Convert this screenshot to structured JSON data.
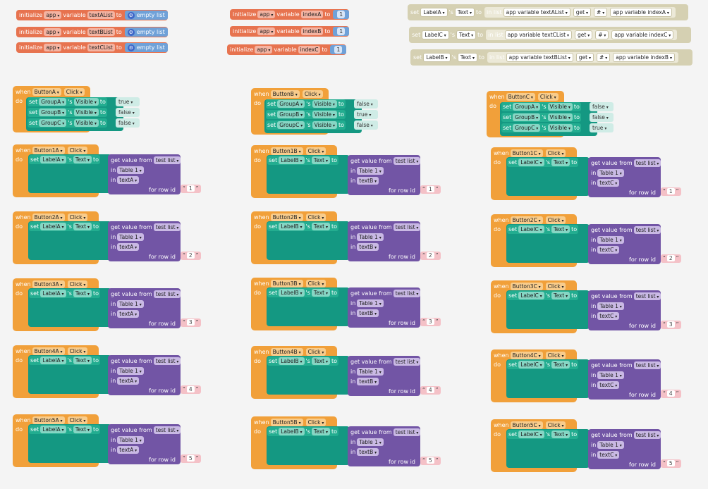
{
  "labels": {
    "initialize": "initialize",
    "app": "app",
    "variable": "variable",
    "to": "to",
    "empty_list": "empty list",
    "set": "set",
    "s_text": "'s",
    "text": "Text",
    "in_list": "in list",
    "app_variable": "app variable",
    "get": "get",
    "hash": "#",
    "when": "when",
    "click": "Click",
    "do": "do",
    "visible": "Visible",
    "get_value_from": "get value from",
    "test_list": "test list",
    "in": "in",
    "table1": "Table 1",
    "for_row_id": "for row id",
    "open_quote": "“",
    "close_quote": "”"
  },
  "initializers": [
    {
      "name": "textAList"
    },
    {
      "name": "textBList"
    },
    {
      "name": "textCList"
    }
  ],
  "index_inits": [
    {
      "name": "indexA",
      "value": "1"
    },
    {
      "name": "indexB",
      "value": "1"
    },
    {
      "name": "indexC",
      "value": "1"
    }
  ],
  "tan_sets": [
    {
      "label": "LabelA",
      "list": "app variable textAList",
      "index": "app variable indexA"
    },
    {
      "label": "LabelC",
      "list": "app variable textCList",
      "index": "app variable indexC"
    },
    {
      "label": "LabelB",
      "list": "app variable textBList",
      "index": "app variable indexB"
    }
  ],
  "visibility_handlers": [
    {
      "button": "ButtonA",
      "rows": [
        {
          "group": "GroupA",
          "value": "true"
        },
        {
          "group": "GroupB",
          "value": "false"
        },
        {
          "group": "GroupC",
          "value": "false"
        }
      ]
    },
    {
      "button": "ButtonB",
      "rows": [
        {
          "group": "GroupA",
          "value": "false"
        },
        {
          "group": "GroupB",
          "value": "true"
        },
        {
          "group": "GroupC",
          "value": "false"
        }
      ]
    },
    {
      "button": "ButtonC",
      "rows": [
        {
          "group": "GroupA",
          "value": "false"
        },
        {
          "group": "GroupB",
          "value": "false"
        },
        {
          "group": "GroupC",
          "value": "true"
        }
      ]
    }
  ],
  "value_handlers": [
    {
      "button": "Button1A",
      "label": "LabelA",
      "field": "textA",
      "row": "1"
    },
    {
      "button": "Button1B",
      "label": "LabelB",
      "field": "textB",
      "row": "1"
    },
    {
      "button": "Button1C",
      "label": "LabelC",
      "field": "textC",
      "row": "1"
    },
    {
      "button": "Button2A",
      "label": "LabelA",
      "field": "textA",
      "row": "2"
    },
    {
      "button": "Button2B",
      "label": "LabelB",
      "field": "textB",
      "row": "2"
    },
    {
      "button": "Button2C",
      "label": "LabelC",
      "field": "textC",
      "row": "2"
    },
    {
      "button": "Button3A",
      "label": "LabelA",
      "field": "textA",
      "row": "3"
    },
    {
      "button": "Button3B",
      "label": "LabelB",
      "field": "textB",
      "row": "3"
    },
    {
      "button": "Button3C",
      "label": "LabelC",
      "field": "textC",
      "row": "3"
    },
    {
      "button": "Button4A",
      "label": "LabelA",
      "field": "textA",
      "row": "4"
    },
    {
      "button": "Button4B",
      "label": "LabelB",
      "field": "textB",
      "row": "4"
    },
    {
      "button": "Button4C",
      "label": "LabelC",
      "field": "textC",
      "row": "4"
    },
    {
      "button": "Button5A",
      "label": "LabelA",
      "field": "textA",
      "row": "5"
    },
    {
      "button": "Button5B",
      "label": "LabelB",
      "field": "textB",
      "row": "5"
    },
    {
      "button": "Button5C",
      "label": "LabelC",
      "field": "textC",
      "row": "5"
    }
  ],
  "colors": {
    "event": "#f1a03a",
    "component": "#149882",
    "init": "#e7734f",
    "purple": "#7255a5",
    "text_block": "#f4c1c7",
    "list_block": "#d5d0b2"
  }
}
